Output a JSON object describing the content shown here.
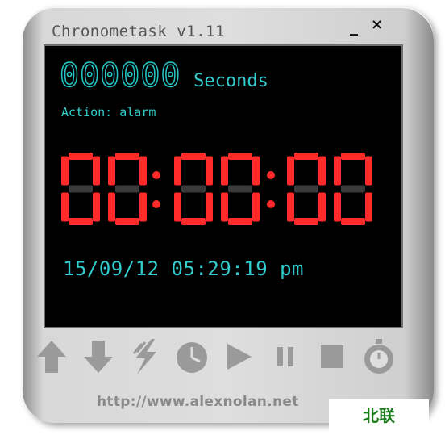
{
  "window": {
    "title": "Chronometask v1.11",
    "minimize_glyph": "_",
    "close_glyph": "×"
  },
  "display": {
    "seconds_counter": "000000",
    "seconds_label": "Seconds",
    "action_text": "Action: alarm",
    "clock_digits": [
      "0",
      "0",
      "0",
      "0",
      "0",
      "0"
    ],
    "datetime": "15/09/12 05:29:19 pm"
  },
  "toolbar": {
    "icons": [
      "arrow-up-icon",
      "arrow-down-icon",
      "lightning-icon",
      "clock-icon",
      "play-icon",
      "pause-icon",
      "stop-icon",
      "stopwatch-icon"
    ]
  },
  "footer": {
    "url": "http://www.alexnolan.net"
  },
  "watermark": {
    "text": "北联"
  },
  "colors": {
    "screen_bg": "#000000",
    "cyan": "#33cccc",
    "red_digits": "#ff2a2a",
    "unlit_segment": "#3a3a3a",
    "icon_gray": "#9a9a9a",
    "frame": "#dedede"
  }
}
